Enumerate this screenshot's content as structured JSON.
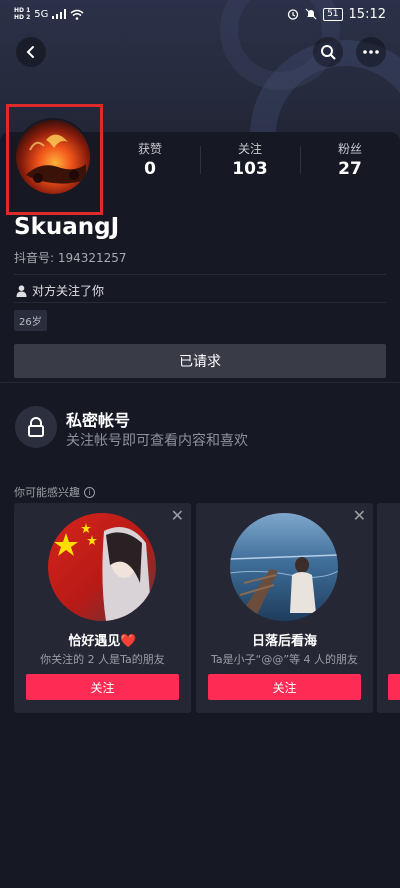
{
  "status_bar": {
    "hd1": "HD 1",
    "hd2": "HD 2",
    "signal": "5G",
    "battery": "51",
    "time": "15:12"
  },
  "profile": {
    "username": "SkuangJ",
    "douyin_id": "抖音号: 194321257",
    "follow_note": "对方关注了你",
    "age": "26岁",
    "stats": [
      {
        "label": "获赞",
        "value": "0"
      },
      {
        "label": "关注",
        "value": "103"
      },
      {
        "label": "粉丝",
        "value": "27"
      }
    ],
    "requested_label": "已请求"
  },
  "private": {
    "title": "私密帐号",
    "description": "关注帐号即可查看内容和喜欢"
  },
  "recommendations": {
    "section_label": "你可能感兴趣",
    "cards": [
      {
        "name": "恰好遇见❤️",
        "subtitle": "你关注的 2 人是Ta的朋友",
        "follow_label": "关注"
      },
      {
        "name": "日落后看海",
        "subtitle": "Ta是小子“@@”等 4 人的朋友",
        "follow_label": "关注"
      },
      {
        "follow_label": ""
      }
    ]
  },
  "colors": {
    "background": "#161823",
    "accent_red": "#fe2c55",
    "highlight_box": "#e02a2a"
  },
  "icons": [
    "back-arrow-icon",
    "search-icon",
    "more-icon",
    "person-icon",
    "lock-icon",
    "info-icon",
    "close-icon"
  ]
}
